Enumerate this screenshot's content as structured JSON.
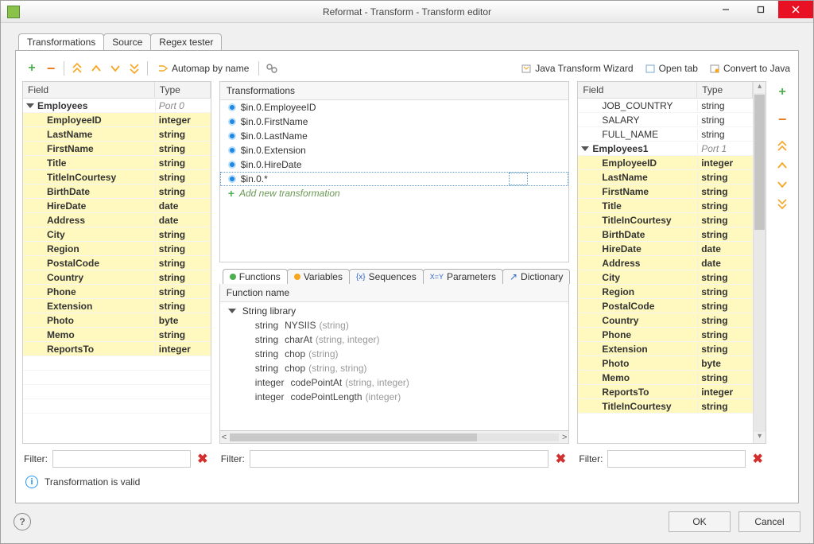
{
  "window": {
    "title": "Reformat - Transform - Transform editor"
  },
  "tabs": {
    "transformations": "Transformations",
    "source": "Source",
    "regex": "Regex tester"
  },
  "toolbar": {
    "automap": "Automap by name",
    "javaWizard": "Java Transform Wizard",
    "openTab": "Open tab",
    "convert": "Convert to Java"
  },
  "leftGrid": {
    "headField": "Field",
    "headType": "Type",
    "port": {
      "name": "Employees",
      "label": "Port 0"
    },
    "rows": [
      {
        "f": "EmployeeID",
        "t": "integer"
      },
      {
        "f": "LastName",
        "t": "string"
      },
      {
        "f": "FirstName",
        "t": "string"
      },
      {
        "f": "Title",
        "t": "string"
      },
      {
        "f": "TitleInCourtesy",
        "t": "string"
      },
      {
        "f": "BirthDate",
        "t": "string"
      },
      {
        "f": "HireDate",
        "t": "date"
      },
      {
        "f": "Address",
        "t": "date"
      },
      {
        "f": "City",
        "t": "string"
      },
      {
        "f": "Region",
        "t": "string"
      },
      {
        "f": "PostalCode",
        "t": "string"
      },
      {
        "f": "Country",
        "t": "string"
      },
      {
        "f": "Phone",
        "t": "string"
      },
      {
        "f": "Extension",
        "t": "string"
      },
      {
        "f": "Photo",
        "t": "byte"
      },
      {
        "f": "Memo",
        "t": "string"
      },
      {
        "f": "ReportsTo",
        "t": "integer"
      }
    ]
  },
  "transformations": {
    "head": "Transformations",
    "items": [
      "$in.0.EmployeeID",
      "$in.0.FirstName",
      "$in.0.LastName",
      "$in.0.Extension",
      "$in.0.HireDate",
      "$in.0.*"
    ],
    "add": "Add new transformation"
  },
  "midTabs": {
    "functions": "Functions",
    "variables": "Variables",
    "sequences": "Sequences",
    "parameters": "Parameters",
    "dictionary": "Dictionary"
  },
  "functions": {
    "head": "Function name",
    "library": "String library",
    "items": [
      {
        "ret": "string",
        "name": "NYSIIS",
        "args": "(string)"
      },
      {
        "ret": "string",
        "name": "charAt",
        "args": "(string, integer)"
      },
      {
        "ret": "string",
        "name": "chop",
        "args": "(string)"
      },
      {
        "ret": "string",
        "name": "chop",
        "args": "(string, string)"
      },
      {
        "ret": "integer",
        "name": "codePointAt",
        "args": "(string, integer)"
      },
      {
        "ret": "integer",
        "name": "codePointLength",
        "args": "(integer)"
      }
    ]
  },
  "rightGrid": {
    "headField": "Field",
    "headType": "Type",
    "pre": [
      {
        "f": "JOB_COUNTRY",
        "t": "string"
      },
      {
        "f": "SALARY",
        "t": "string"
      },
      {
        "f": "FULL_NAME",
        "t": "string"
      }
    ],
    "port": {
      "name": "Employees1",
      "label": "Port 1"
    },
    "rows": [
      {
        "f": "EmployeeID",
        "t": "integer"
      },
      {
        "f": "LastName",
        "t": "string"
      },
      {
        "f": "FirstName",
        "t": "string"
      },
      {
        "f": "Title",
        "t": "string"
      },
      {
        "f": "TitleInCourtesy",
        "t": "string"
      },
      {
        "f": "BirthDate",
        "t": "string"
      },
      {
        "f": "HireDate",
        "t": "date"
      },
      {
        "f": "Address",
        "t": "date"
      },
      {
        "f": "City",
        "t": "string"
      },
      {
        "f": "Region",
        "t": "string"
      },
      {
        "f": "PostalCode",
        "t": "string"
      },
      {
        "f": "Country",
        "t": "string"
      },
      {
        "f": "Phone",
        "t": "string"
      },
      {
        "f": "Extension",
        "t": "string"
      },
      {
        "f": "Photo",
        "t": "byte"
      },
      {
        "f": "Memo",
        "t": "string"
      },
      {
        "f": "ReportsTo",
        "t": "integer"
      },
      {
        "f": "TitleInCourtesy",
        "t": "string"
      }
    ]
  },
  "filter": {
    "label": "Filter:",
    "placeholder": ""
  },
  "status": "Transformation is valid",
  "buttons": {
    "ok": "OK",
    "cancel": "Cancel"
  }
}
